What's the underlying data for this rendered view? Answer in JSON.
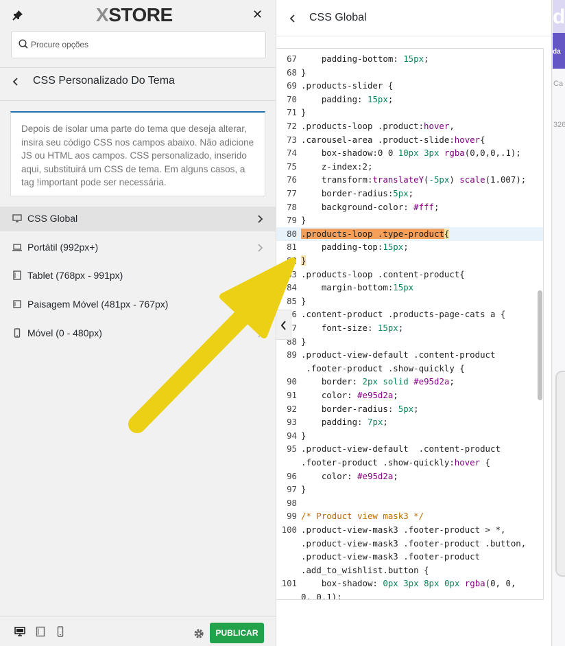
{
  "header": {
    "logo_prefix": "X",
    "logo_text": "STORE",
    "search_placeholder": "Procure opções"
  },
  "section": {
    "title": "CSS Personalizado Do Tema",
    "description": "Depois de isolar uma parte do tema que deseja alterar, insira seu código CSS nos campos abaixo. Não adicione JS ou HTML aos campos. CSS personalizado, inserido aqui, substituirá um CSS de tema. Em alguns casos, a tag !important pode ser necessária."
  },
  "menu": {
    "items": [
      {
        "label": "CSS Global",
        "icon": "desktop-icon"
      },
      {
        "label": "Portátil (992px+)",
        "icon": "laptop-icon"
      },
      {
        "label": "Tablet (768px - 991px)",
        "icon": "tablet-icon"
      },
      {
        "label": "Paisagem Móvel (481px - 767px)",
        "icon": "tablet-landscape-icon"
      },
      {
        "label": "Móvel (0 - 480px)",
        "icon": "smartphone-icon"
      }
    ]
  },
  "footer": {
    "publish_label": "PUBLICAR"
  },
  "editor": {
    "title": "CSS Global",
    "highlighted_line": 80,
    "lines": [
      {
        "n": "67",
        "code": "    padding-bottom: 15px;"
      },
      {
        "n": "68",
        "code": "}"
      },
      {
        "n": "69",
        "code": ".products-slider {"
      },
      {
        "n": "70",
        "code": "    padding: 15px;"
      },
      {
        "n": "71",
        "code": "}"
      },
      {
        "n": "72",
        "code": ".products-loop .product:hover,"
      },
      {
        "n": "73",
        "code": ".carousel-area .product-slide:hover{"
      },
      {
        "n": "74",
        "code": "    box-shadow:0 0 10px 3px rgba(0,0,0,.1);"
      },
      {
        "n": "75",
        "code": "    z-index:2;"
      },
      {
        "n": "76",
        "code": "    transform:translateY(-5px) scale(1.007);"
      },
      {
        "n": "77",
        "code": "    border-radius:5px;"
      },
      {
        "n": "78",
        "code": "    background-color: #fff;"
      },
      {
        "n": "79",
        "code": "}"
      },
      {
        "n": "80",
        "code": ".products-loop .type-product{"
      },
      {
        "n": "81",
        "code": "    padding-top:15px;"
      },
      {
        "n": "82",
        "code": "}"
      },
      {
        "n": "83",
        "code": ".products-loop .content-product{"
      },
      {
        "n": "84",
        "code": "    margin-bottom:15px"
      },
      {
        "n": "85",
        "code": "}"
      },
      {
        "n": "86",
        "code": ".content-product .products-page-cats a {"
      },
      {
        "n": "87",
        "code": "    font-size: 15px;"
      },
      {
        "n": "88",
        "code": "}"
      },
      {
        "n": "89",
        "code": ".product-view-default .content-product"
      },
      {
        "n": "",
        "code": " .footer-product .show-quickly {"
      },
      {
        "n": "90",
        "code": "    border: 2px solid #e95d2a;"
      },
      {
        "n": "91",
        "code": "    color: #e95d2a;"
      },
      {
        "n": "92",
        "code": "    border-radius: 5px;"
      },
      {
        "n": "93",
        "code": "    padding: 7px;"
      },
      {
        "n": "94",
        "code": "}"
      },
      {
        "n": "95",
        "code": ".product-view-default  .content-product"
      },
      {
        "n": "",
        "code": ".footer-product .show-quickly:hover {"
      },
      {
        "n": "96",
        "code": "    color: #e95d2a;"
      },
      {
        "n": "97",
        "code": "}"
      },
      {
        "n": "98",
        "code": ""
      },
      {
        "n": "99",
        "code": "/* Product view mask3 */"
      },
      {
        "n": "100",
        "code": ".product-view-mask3 .footer-product > *,"
      },
      {
        "n": "",
        "code": ".product-view-mask3 .footer-product .button,"
      },
      {
        "n": "",
        "code": ".product-view-mask3 .footer-product"
      },
      {
        "n": "",
        "code": ".add_to_wishlist.button {"
      },
      {
        "n": "101",
        "code": "    box-shadow: 0px 3px 8px 0px rgba(0, 0,"
      },
      {
        "n": "",
        "code": "0, 0.1);"
      }
    ]
  },
  "preview": {
    "logo_fragment": "da",
    "nav_fragment": "Ca",
    "price_fragment": "326"
  },
  "colors": {
    "accent": "#2271b1",
    "publish": "#22a24b",
    "annotation_arrow": "#f0d010",
    "selector_highlight": "#f5a05a",
    "active_line": "#e8f2fb"
  }
}
